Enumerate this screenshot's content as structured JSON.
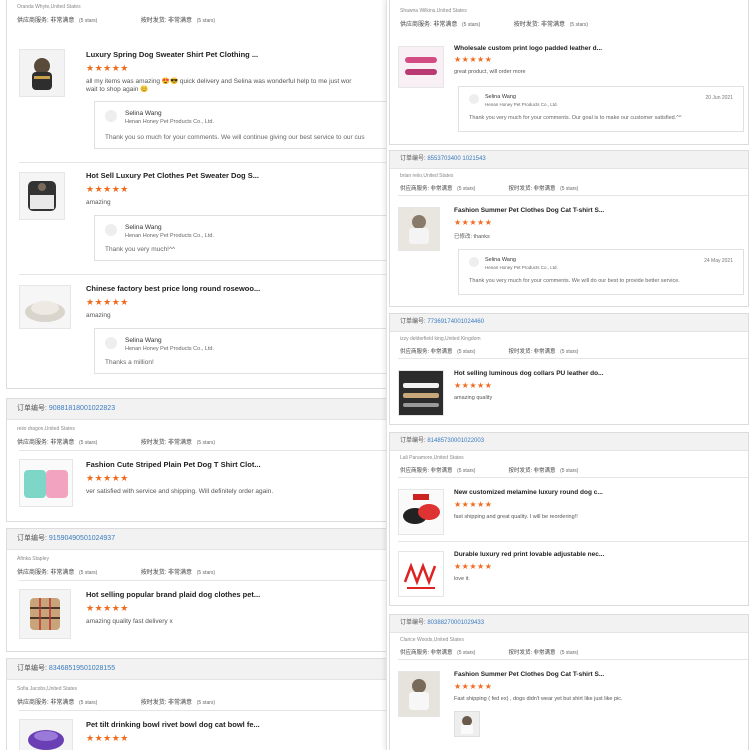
{
  "colors": {
    "star": "#ef6c1f",
    "order_link": "#3a7bbf",
    "header_bg": "#f2f2f2"
  },
  "labels": {
    "order_no": "订单编号:",
    "seller_service": "供应商服务: 非常满意",
    "shipping": "按时发货: 非常满意",
    "five_stars": "(5 stars)",
    "stars": "★★★★★"
  },
  "left": {
    "card1": {
      "buyer": "Oranda Whyte,United States",
      "items": [
        {
          "title": "Luxury Spring Dog Sweater Shirt Pet Clothing ...",
          "comment": "all my items was amazing 😍😎 quick delivery  and Selina was wonderful help to me  just wor",
          "comment2": "wait to shop again 😊",
          "reply_name": "Selina Wang",
          "reply_company": "Henan Honey Pet Products Co., Ltd.",
          "reply_text": "Thank you so much for your comments. We will continue giving our best service to our cus"
        },
        {
          "title": "Hot Sell Luxury Pet Clothes Pet Sweater Dog S...",
          "comment": "amazing",
          "reply_name": "Selina Wang",
          "reply_company": "Henan Honey Pet Products Co., Ltd.",
          "reply_text": "Thank you very much!^^"
        },
        {
          "title": "Chinese factory best price long round rosewoo...",
          "comment": "amazing",
          "reply_name": "Selina Wang",
          "reply_company": "Henan Honey Pet Products Co., Ltd.",
          "reply_text": "Thanks a million!"
        }
      ]
    },
    "card2": {
      "order_no": "90881818001022823",
      "buyer": "reiio dragon,United States",
      "title": "Fashion Cute Striped Plain Pet Dog T Shirt Clot...",
      "comment": "ver satisfied with service and shipping. Will definitely order again."
    },
    "card3": {
      "order_no": "91590490501024937",
      "buyer": "Afinka Stapley",
      "title": "Hot selling popular brand plaid dog clothes pet...",
      "comment": "amazing quality fast delivery x"
    },
    "card4": {
      "order_no": "83468519501028155",
      "buyer": "Sofia Jacobs,United States",
      "title": "Pet tilt drinking bowl rivet bowl dog cat bowl fe..."
    }
  },
  "right": {
    "card1": {
      "buyer": "Shawna Wilkins,United States",
      "title": "Wholesale custom print logo padded leather d...",
      "comment": "great product, will order more",
      "reply_name": "Selina Wang",
      "reply_company": "Henan Honey Pet Products Co., Ltd.",
      "reply_date": "20 Jun 2021",
      "reply_text": "Thank you very much for your comments.  Our goal is to make our customer satisfied.^^"
    },
    "card2": {
      "order_no": "8553703400 1021543",
      "buyer": "brian reiio,United States",
      "title": "Fashion Summer Pet Clothes Dog Cat T-shirt S...",
      "comment": "已修改: thanks",
      "reply_name": "Selina Wang",
      "reply_company": "Henan Honey Pet Products Co., Ltd.",
      "reply_date": "24 May 2021",
      "reply_text": "Thank you very much for your comments. We will do our best to provide better service."
    },
    "card3": {
      "order_no": "77369174001024460",
      "buyer": "izzy delderfield king,United Kingdom",
      "title": "Hot selling luminous dog collars PU leather do...",
      "comment": "amazing quality"
    },
    "card4": {
      "order_no": "81485730001022003",
      "buyer": "Lali Panamore,United States",
      "items": [
        {
          "title": "New customized melamine luxury round dog c...",
          "comment": "fast shipping and great quality. I will be reordering!!"
        },
        {
          "title": "Durable luxury red print lovable adjustable nec...",
          "comment": "love it."
        }
      ]
    },
    "card5": {
      "order_no": "80388270001029433",
      "buyer": "Clarice Woods,United States",
      "title": "Fashion Summer Pet Clothes Dog Cat T-shirt S...",
      "comment": "Fast shipping ( fed ex) , dogs didn't wear yet but shirt like just like pic."
    }
  }
}
